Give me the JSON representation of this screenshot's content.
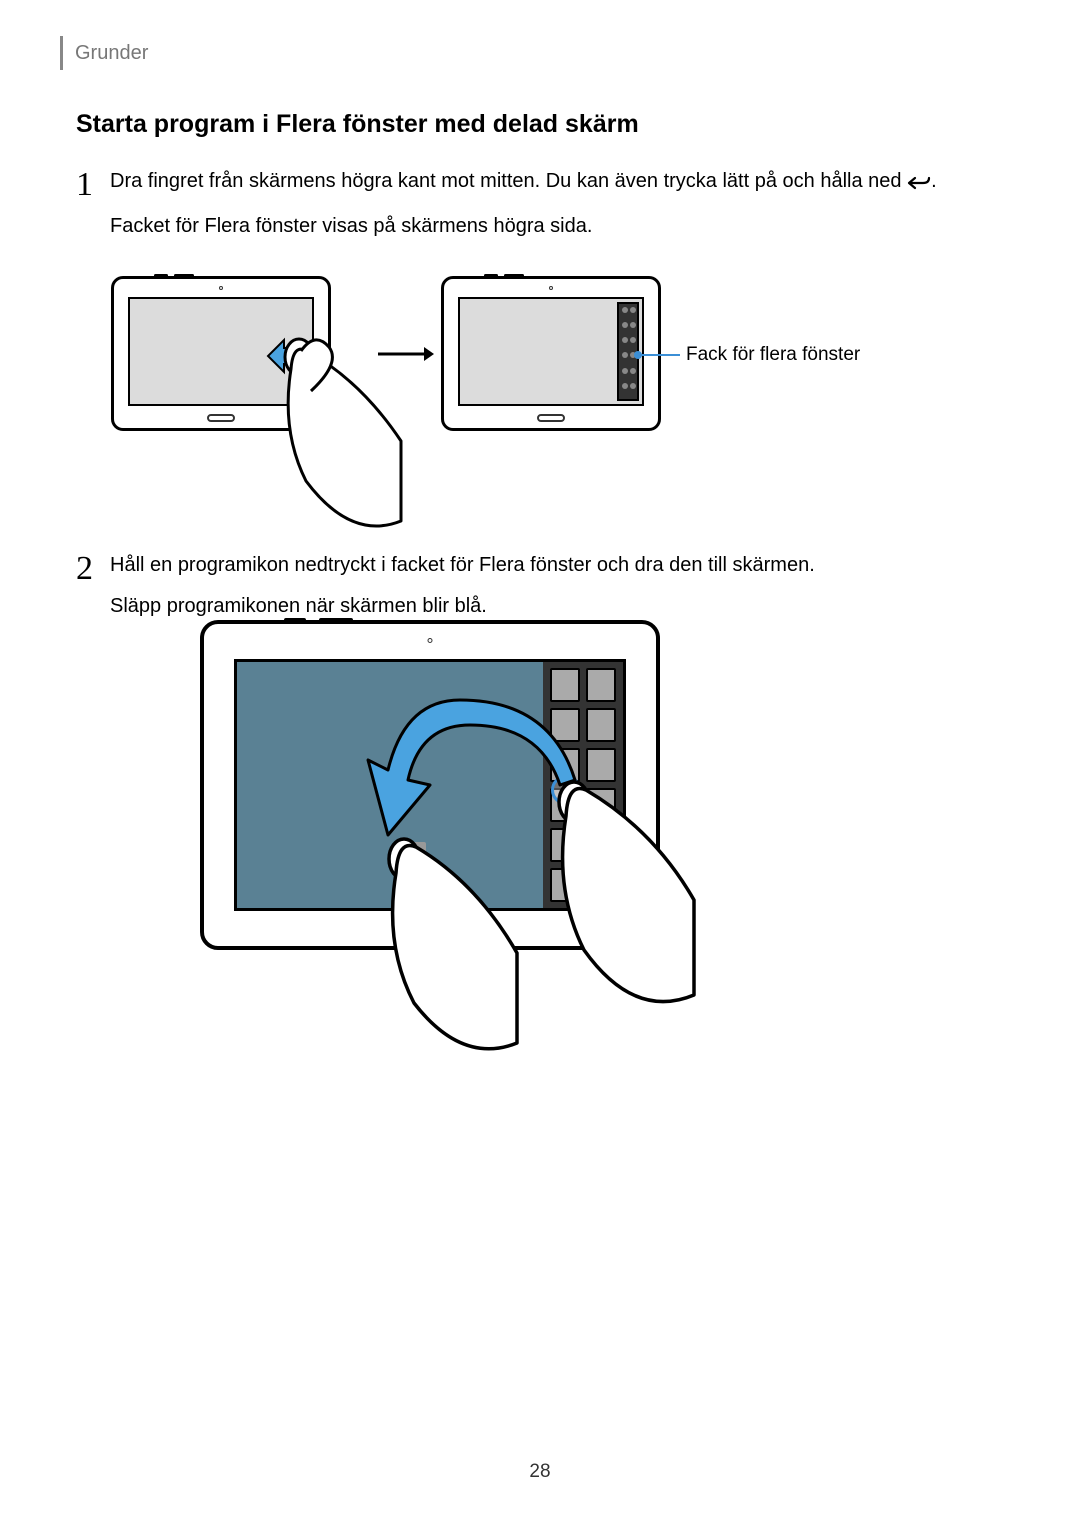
{
  "header": {
    "section": "Grunder"
  },
  "title": "Starta program i Flera fönster med delad skärm",
  "step1": {
    "num": "1",
    "p1_a": "Dra fingret från skärmens högra kant mot mitten. Du kan även trycka lätt på och hålla ned ",
    "p1_b": ".",
    "p2": "Facket för Flera fönster visas på skärmens högra sida."
  },
  "callout1": "Fack för flera fönster",
  "step2": {
    "num": "2",
    "p1": "Håll en programikon nedtryckt i facket för Flera fönster och dra den till skärmen.",
    "p2": "Släpp programikonen när skärmen blir blå."
  },
  "page": "28"
}
